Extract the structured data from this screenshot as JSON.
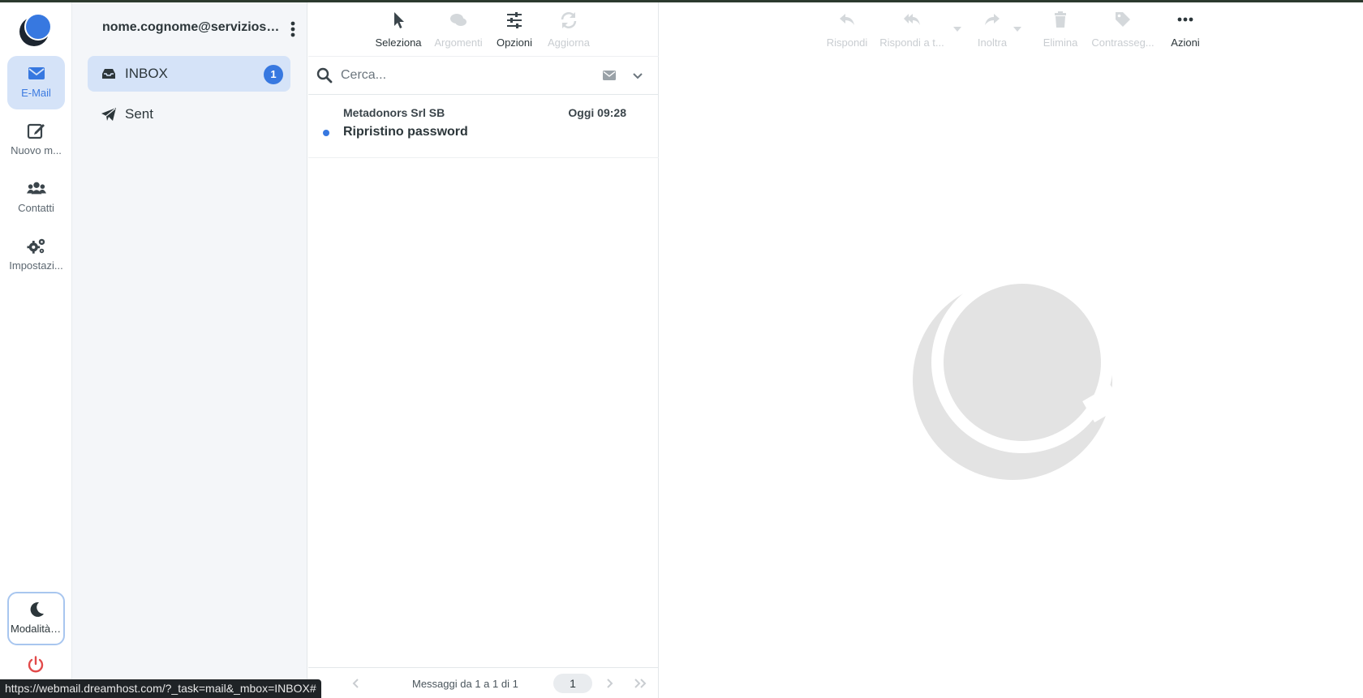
{
  "nav": {
    "items": [
      {
        "label": "E-Mail",
        "icon": "envelope-icon",
        "active": true
      },
      {
        "label": "Nuovo m...",
        "icon": "compose-icon",
        "active": false
      },
      {
        "label": "Contatti",
        "icon": "users-icon",
        "active": false
      },
      {
        "label": "Impostazi...",
        "icon": "gears-icon",
        "active": false
      }
    ],
    "dark_mode_label": "Modalità ...",
    "accent": "#3778e0"
  },
  "folders": {
    "account": "nome.cognome@serviziosost...",
    "items": [
      {
        "label": "INBOX",
        "icon": "inbox-icon",
        "unread": "1",
        "active": true
      },
      {
        "label": "Sent",
        "icon": "paper-plane-icon",
        "active": false
      }
    ]
  },
  "list_toolbar": {
    "select": "Seleziona",
    "threads": "Argomenti",
    "options": "Opzioni",
    "refresh": "Aggiorna"
  },
  "search": {
    "placeholder": "Cerca..."
  },
  "messages": [
    {
      "from": "Metadonors Srl SB",
      "date": "Oggi 09:28",
      "subject": "Ripristino password",
      "unread": true
    }
  ],
  "pager": {
    "count_text": "Messaggi da 1 a 1 di 1",
    "page": "1"
  },
  "preview_toolbar": {
    "reply": "Rispondi",
    "reply_all": "Rispondi a t...",
    "forward": "Inoltra",
    "delete": "Elimina",
    "flag": "Contrasseg...",
    "actions": "Azioni"
  },
  "status_url": "https://webmail.dreamhost.com/?_task=mail&_mbox=INBOX#"
}
